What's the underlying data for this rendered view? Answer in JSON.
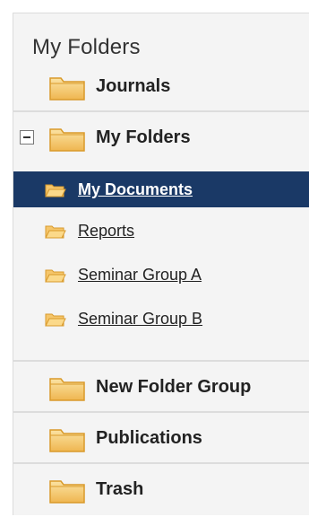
{
  "panel": {
    "title": "My Folders"
  },
  "groups": {
    "journals": {
      "label": "Journals"
    },
    "my_folders": {
      "label": "My Folders",
      "expanded": true
    },
    "new_folder_group": {
      "label": "New Folder Group"
    },
    "publications": {
      "label": "Publications"
    },
    "trash": {
      "label": "Trash"
    }
  },
  "folders": [
    {
      "label": "My Documents",
      "selected": true
    },
    {
      "label": "Reports",
      "selected": false
    },
    {
      "label": "Seminar Group A",
      "selected": false
    },
    {
      "label": "Seminar Group B",
      "selected": false
    }
  ],
  "colors": {
    "selected_bg": "#1a3966",
    "folder_fill": "#f5c66b",
    "folder_stroke": "#d99a2b"
  },
  "icons": {
    "group_icon": "folder-icon",
    "folder_icon": "folder-open-icon",
    "toggle_icon": "collapse-icon"
  }
}
